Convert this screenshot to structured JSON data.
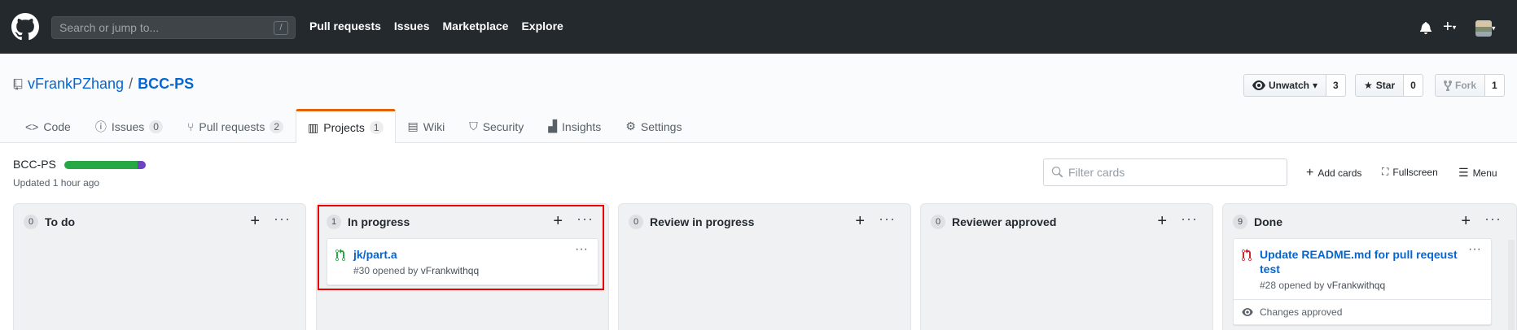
{
  "header": {
    "search_placeholder": "Search or jump to...",
    "search_shortcut": "/",
    "nav": [
      "Pull requests",
      "Issues",
      "Marketplace",
      "Explore"
    ],
    "plus_label": "+"
  },
  "repo": {
    "owner": "vFrankPZhang",
    "separator": "/",
    "name": "BCC-PS",
    "watch_label": "Unwatch",
    "watch_count": "3",
    "star_label": "Star",
    "star_count": "0",
    "fork_label": "Fork",
    "fork_count": "1"
  },
  "tabs": [
    {
      "label": "Code",
      "icon": "code-icon"
    },
    {
      "label": "Issues",
      "count": "0",
      "icon": "issue-icon"
    },
    {
      "label": "Pull requests",
      "count": "2",
      "icon": "pull-request-icon"
    },
    {
      "label": "Projects",
      "count": "1",
      "icon": "project-icon",
      "selected": true
    },
    {
      "label": "Wiki",
      "icon": "wiki-icon"
    },
    {
      "label": "Security",
      "icon": "shield-icon"
    },
    {
      "label": "Insights",
      "icon": "graph-icon"
    },
    {
      "label": "Settings",
      "icon": "gear-icon"
    }
  ],
  "project": {
    "name": "BCC-PS",
    "updated": "Updated 1 hour ago",
    "progress_done_fraction": 0.9,
    "progress_in_progress_fraction": 0.1,
    "filter_placeholder": "Filter cards",
    "add_cards": "Add cards",
    "fullscreen": "Fullscreen",
    "menu": "Menu"
  },
  "columns": [
    {
      "count": "0",
      "title": "To do"
    },
    {
      "count": "1",
      "title": "In progress"
    },
    {
      "count": "0",
      "title": "Review in progress"
    },
    {
      "count": "0",
      "title": "Reviewer approved"
    },
    {
      "count": "9",
      "title": "Done"
    }
  ],
  "cards": {
    "in_progress": {
      "title": "jk/part.a",
      "meta": "#30 opened by ",
      "user": "vFrankwithqq",
      "icon_color": "#28a745"
    },
    "done": {
      "title": "Update README.md for pull reqeust test",
      "meta": "#28 opened by ",
      "user": "vFrankwithqq",
      "footer": "Changes approved",
      "icon_color": "#cb2431"
    }
  },
  "colors": {
    "header_bg": "#24292e",
    "link": "#0366d6",
    "tab_accent": "#e36209",
    "progress_done": "#28a745",
    "progress_in_progress": "#6f42c1",
    "highlight": "#ee0000"
  }
}
